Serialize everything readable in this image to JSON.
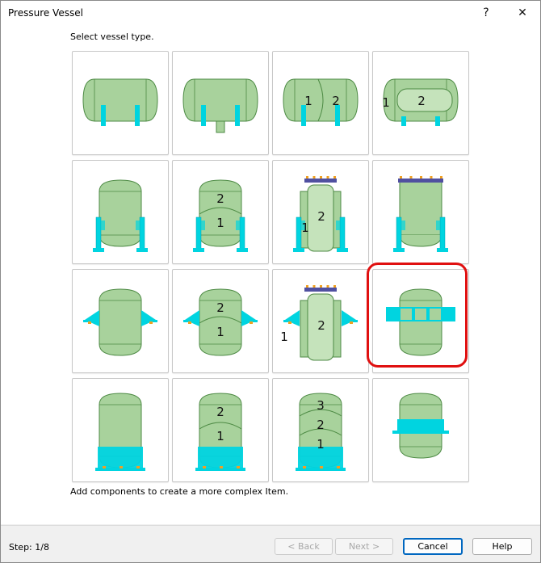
{
  "window": {
    "title": "Pressure Vessel",
    "help_glyph": "?",
    "close_glyph": "✕"
  },
  "content": {
    "prompt": "Select vessel type.",
    "footnote": "Add components to create a more complex Item.",
    "selected_index": 11
  },
  "tiles": [
    {
      "name": "vessel-type-horizontal-legs",
      "labels": []
    },
    {
      "name": "vessel-type-horizontal-legs-nozzle",
      "labels": []
    },
    {
      "name": "vessel-type-horizontal-two-compartment",
      "labels": [
        "1",
        "2"
      ]
    },
    {
      "name": "vessel-type-horizontal-jacketed",
      "labels": [
        "1",
        "2"
      ]
    },
    {
      "name": "vessel-type-vertical-legs",
      "labels": []
    },
    {
      "name": "vessel-type-vertical-legs-two-section",
      "labels": [
        "2",
        "1"
      ]
    },
    {
      "name": "vessel-type-vertical-legs-jacketed-flange",
      "labels": [
        "2",
        "1"
      ]
    },
    {
      "name": "vessel-type-vertical-legs-flange",
      "labels": []
    },
    {
      "name": "vessel-type-vertical-lugs",
      "labels": []
    },
    {
      "name": "vessel-type-vertical-lugs-two-section",
      "labels": [
        "2",
        "1"
      ]
    },
    {
      "name": "vessel-type-vertical-lugs-jacketed-flange",
      "labels": [
        "2",
        "1"
      ]
    },
    {
      "name": "vessel-type-vertical-ring-girder",
      "labels": []
    },
    {
      "name": "vessel-type-vertical-skirt",
      "labels": []
    },
    {
      "name": "vessel-type-vertical-skirt-two-section",
      "labels": [
        "2",
        "1"
      ]
    },
    {
      "name": "vessel-type-vertical-skirt-three-section",
      "labels": [
        "3",
        "2",
        "1"
      ]
    },
    {
      "name": "vessel-type-vertical-mid-skirt",
      "labels": []
    }
  ],
  "footer": {
    "step": "Step: 1/8",
    "back": "< Back",
    "next": "Next >",
    "cancel": "Cancel",
    "help": "Help"
  },
  "colors": {
    "vessel_fill": "#a8d29c",
    "vessel_stroke": "#4d8a44",
    "support_fill": "#00d4e0",
    "flange_fill": "#5050a0",
    "bolt_fill": "#f0a020",
    "selection": "#e01010",
    "primary_button_border": "#0067c0"
  }
}
